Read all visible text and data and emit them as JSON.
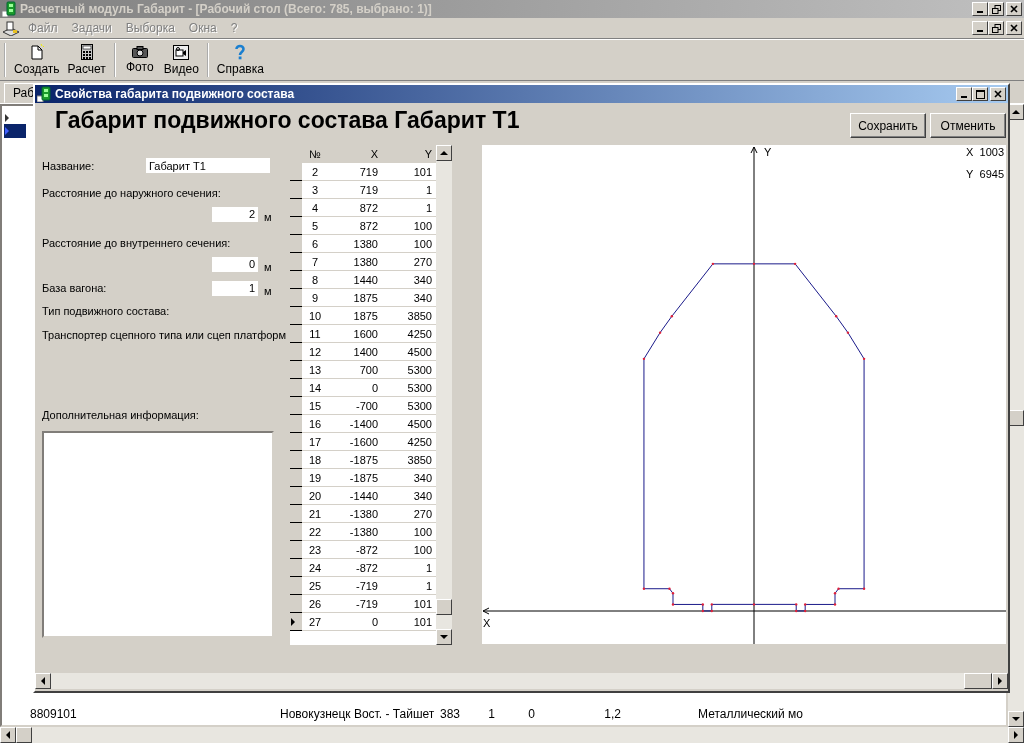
{
  "app": {
    "title": "Расчетный модуль Габарит - [Рабочий стол (Всего: 785, выбрано: 1)]"
  },
  "menu": [
    {
      "label": "Файл",
      "disabled": true
    },
    {
      "label": "Задачи",
      "disabled": true
    },
    {
      "label": "Выборка",
      "disabled": true
    },
    {
      "label": "Окна",
      "disabled": true
    },
    {
      "label": "?",
      "disabled": true
    }
  ],
  "toolbar": [
    {
      "buttons": [
        {
          "label": "Создать",
          "kind": "new"
        },
        {
          "label": "Расчет",
          "kind": "calc"
        }
      ]
    },
    {
      "buttons": [
        {
          "label": "Фото",
          "kind": "photo"
        },
        {
          "label": "Видео",
          "kind": "video"
        }
      ]
    },
    {
      "buttons": [
        {
          "label": "Справка",
          "kind": "help"
        }
      ]
    }
  ],
  "workspace": {
    "tab": "Раб",
    "rows": [
      {
        "cells": [
          "8809101",
          "Новокузнецк Вост. - Тайшет",
          "383",
          "1",
          "0",
          "1,2",
          "Металлический мо"
        ]
      }
    ]
  },
  "dialog": {
    "title": "Свойства габарита подвижного состава",
    "heading": "Габарит подвижного состава Габарит Т1",
    "buttons": [
      "Сохранить",
      "Отменить"
    ],
    "fields": [
      {
        "kind": "text",
        "label": "Название:",
        "value": "Габарит Т1"
      },
      {
        "kind": "measure",
        "label": "Расстояние до наружного сечения:",
        "value": "2",
        "unit": "м"
      },
      {
        "kind": "measure",
        "label": "Расстояние до внутреннего сечения:",
        "value": "0",
        "unit": "м"
      },
      {
        "kind": "inline",
        "label": "База вагона:",
        "value": "1",
        "unit": "м"
      },
      {
        "kind": "static",
        "label": "Тип подвижного состава:",
        "value": "Транспортер сцепного типа или сцеп платформ"
      },
      {
        "kind": "memo",
        "label": "Дополнительная информация:"
      }
    ],
    "table": {
      "columns": [
        "№",
        "X",
        "Y"
      ],
      "rows": [
        {
          "cells": [
            "2",
            "719",
            "101"
          ],
          "selected": false
        },
        {
          "cells": [
            "3",
            "719",
            "1"
          ],
          "selected": false
        },
        {
          "cells": [
            "4",
            "872",
            "1"
          ],
          "selected": false
        },
        {
          "cells": [
            "5",
            "872",
            "100"
          ],
          "selected": false
        },
        {
          "cells": [
            "6",
            "1380",
            "100"
          ],
          "selected": false
        },
        {
          "cells": [
            "7",
            "1380",
            "270"
          ],
          "selected": false
        },
        {
          "cells": [
            "8",
            "1440",
            "340"
          ],
          "selected": false
        },
        {
          "cells": [
            "9",
            "1875",
            "340"
          ],
          "selected": false
        },
        {
          "cells": [
            "10",
            "1875",
            "3850"
          ],
          "selected": false
        },
        {
          "cells": [
            "11",
            "1600",
            "4250"
          ],
          "selected": false
        },
        {
          "cells": [
            "12",
            "1400",
            "4500"
          ],
          "selected": false
        },
        {
          "cells": [
            "13",
            "700",
            "5300"
          ],
          "selected": false
        },
        {
          "cells": [
            "14",
            "0",
            "5300"
          ],
          "selected": false
        },
        {
          "cells": [
            "15",
            "-700",
            "5300"
          ],
          "selected": false
        },
        {
          "cells": [
            "16",
            "-1400",
            "4500"
          ],
          "selected": false
        },
        {
          "cells": [
            "17",
            "-1600",
            "4250"
          ],
          "selected": false
        },
        {
          "cells": [
            "18",
            "-1875",
            "3850"
          ],
          "selected": false
        },
        {
          "cells": [
            "19",
            "-1875",
            "340"
          ],
          "selected": false
        },
        {
          "cells": [
            "20",
            "-1440",
            "340"
          ],
          "selected": false
        },
        {
          "cells": [
            "21",
            "-1380",
            "270"
          ],
          "selected": false
        },
        {
          "cells": [
            "22",
            "-1380",
            "100"
          ],
          "selected": false
        },
        {
          "cells": [
            "23",
            "-872",
            "100"
          ],
          "selected": false
        },
        {
          "cells": [
            "24",
            "-872",
            "1"
          ],
          "selected": false
        },
        {
          "cells": [
            "25",
            "-719",
            "1"
          ],
          "selected": false
        },
        {
          "cells": [
            "26",
            "-719",
            "101"
          ],
          "selected": false
        },
        {
          "cells": [
            "27",
            "0",
            "101"
          ],
          "selected": true
        }
      ]
    },
    "plot": {
      "x_axis": "X",
      "y_axis": "Y",
      "readout": [
        {
          "axis": "X",
          "value": "1003"
        },
        {
          "axis": "Y",
          "value": "6945"
        }
      ]
    }
  }
}
